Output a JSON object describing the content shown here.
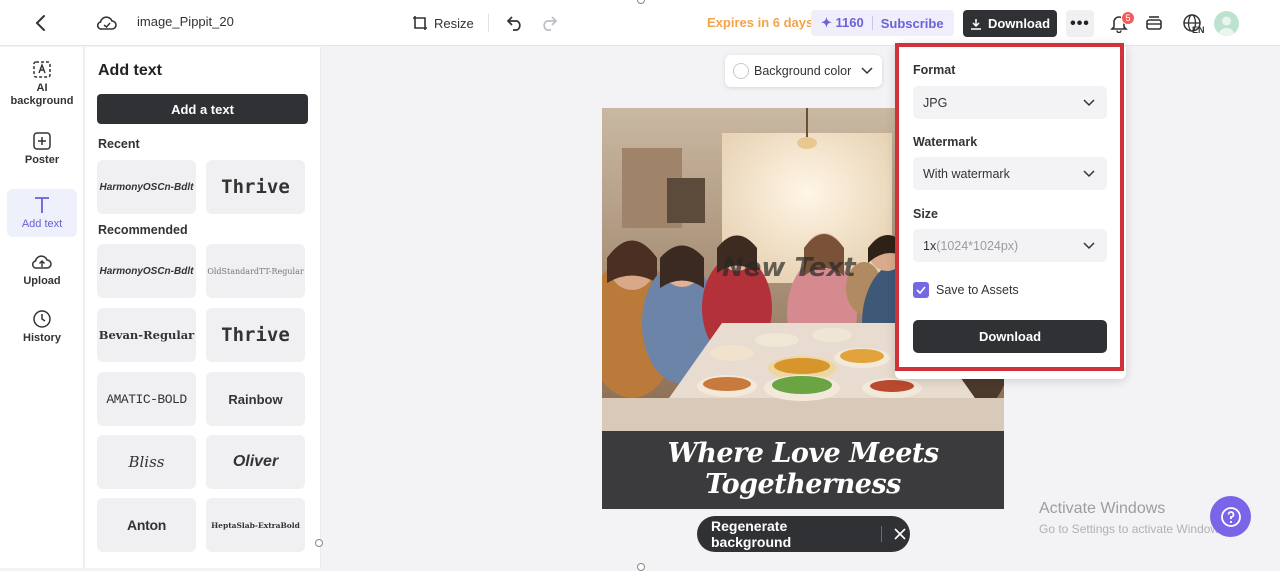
{
  "header": {
    "file_name": "image_Pippit_20",
    "resize_label": "Resize",
    "expires": "Expires in 6 days",
    "credits": "1160",
    "subscribe": "Subscribe",
    "download_label": "Download",
    "more": "•••",
    "notification_count": "5",
    "language": "EN"
  },
  "rail": [
    {
      "label": "AI background",
      "icon": "ai-background-icon"
    },
    {
      "label": "Poster",
      "icon": "poster-icon"
    },
    {
      "label": "Add text",
      "icon": "text-icon",
      "active": true
    },
    {
      "label": "Upload",
      "icon": "upload-icon"
    },
    {
      "label": "History",
      "icon": "history-icon"
    }
  ],
  "panel": {
    "title": "Add text",
    "add_button": "Add a text",
    "recent_label": "Recent",
    "recommended_label": "Recommended",
    "recent_fonts": [
      "HarmonyOSCn-Bdlt",
      "Thrive"
    ],
    "recommended_fonts": [
      "HarmonyOSCn-Bdlt",
      "OldStandardTT-Regular",
      "Bevan-Regular",
      "Thrive",
      "Amatic-Bold",
      "Rainbow",
      "Bliss",
      "Oliver",
      "Anton",
      "HeptaSlab-ExtraBold"
    ]
  },
  "canvas": {
    "background_color_label": "Background color",
    "overlay_text": "New Text",
    "caption": "Where Love Meets Togetherness",
    "regenerate_label": "Regenerate background"
  },
  "download_panel": {
    "format_label": "Format",
    "format_value": "JPG",
    "watermark_label": "Watermark",
    "watermark_value": "With watermark",
    "size_label": "Size",
    "size_scale": "1x",
    "size_dims": "(1024*1024px)",
    "save_to_assets_label": "Save to Assets",
    "save_to_assets_checked": true,
    "download_button": "Download"
  },
  "system": {
    "activate_title": "Activate Windows",
    "activate_sub": "Go to Settings to activate Windows."
  },
  "colors": {
    "accent": "#7469e3",
    "highlight_border": "#d1323a",
    "expires": "#f3a34a",
    "dark_button": "#303134"
  }
}
